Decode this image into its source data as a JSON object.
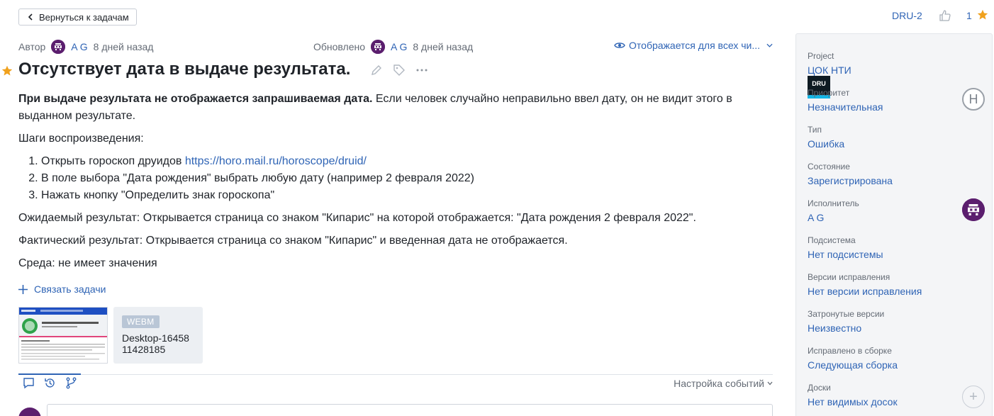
{
  "header": {
    "back_label": "Вернуться к задачам",
    "issue_id": "DRU-2",
    "star_count": "1"
  },
  "meta": {
    "author_label": "Автор",
    "author_name": "A G",
    "author_time": "8 дней назад",
    "updated_label": "Обновлено",
    "updated_name": "A G",
    "updated_time": "8 дней назад",
    "visibility": "Отображается для всех чи..."
  },
  "issue": {
    "title": "Отсутствует дата в выдаче результата.",
    "description": {
      "bold_intro": "При выдаче результата не отображается запрашиваемая дата.",
      "intro_rest": " Если человек случайно неправильно ввел дату, он не видит этого в выданном результате.",
      "steps_heading": "Шаги воспроизведения:",
      "step1_text": "Открыть гороскоп друидов ",
      "step1_link": "https://horo.mail.ru/horoscope/druid/",
      "step2": "В поле выбора \"Дата рождения\" выбрать любую дату (например 2 февраля 2022)",
      "step3": "Нажать кнопку \"Определить знак гороскопа\"",
      "expected": "Ожидаемый результат: Открывается страница со знаком \"Кипарис\" на которой отображается: \"Дата рождения 2 февраля 2022\".",
      "actual": "Фактический результат: Открывается страница со знаком \"Кипарис\" и введенная дата не отображается.",
      "env": "Среда: не имеет значения"
    },
    "link_issues_label": "Связать задачи",
    "attachment_file": {
      "type": "WEBM",
      "name": "Desktop-1645811428185"
    },
    "events_setting_label": "Настройка событий"
  },
  "sidebar": {
    "fields": [
      {
        "label": "Project",
        "value": "ЦОК НТИ",
        "icon": "DRU"
      },
      {
        "label": "Приоритет",
        "value": "Незначительная",
        "icon": "Н"
      },
      {
        "label": "Тип",
        "value": "Ошибка"
      },
      {
        "label": "Состояние",
        "value": "Зарегистрирована"
      },
      {
        "label": "Исполнитель",
        "value": "A G"
      },
      {
        "label": "Подсистема",
        "value": "Нет подсистемы"
      },
      {
        "label": "Версии исправления",
        "value": "Нет версии исправления"
      },
      {
        "label": "Затронутые версии",
        "value": "Неизвестно"
      },
      {
        "label": "Исправлено в сборке",
        "value": "Следующая сборка"
      },
      {
        "label": "Доски",
        "value": "Нет видимых досок"
      }
    ]
  },
  "colors": {
    "link": "#2f64b5",
    "star": "#f0a11d",
    "avatar": "#5b1e6e",
    "sidebar_bg": "#f4f5f7"
  }
}
